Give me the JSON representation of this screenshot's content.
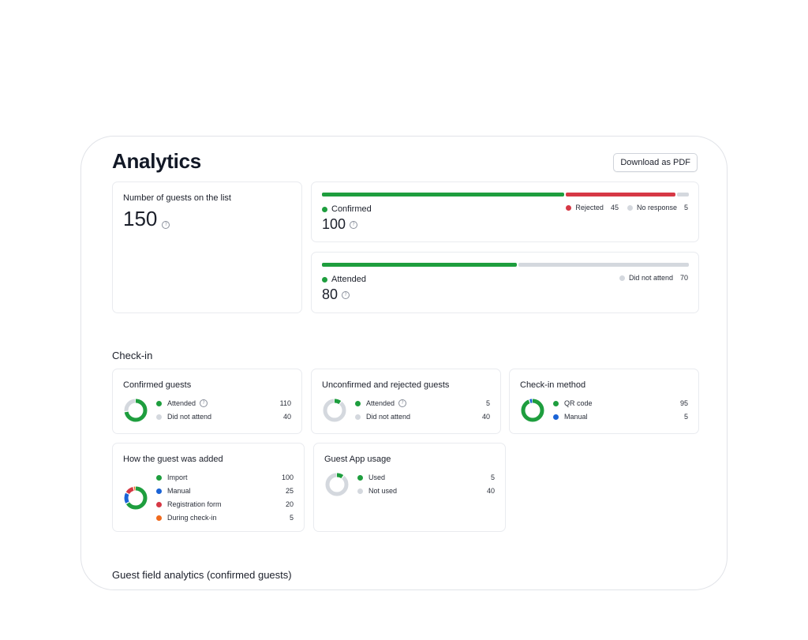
{
  "page": {
    "title": "Analytics",
    "download_label": "Download as PDF"
  },
  "colors": {
    "green": "#1e9e3e",
    "red": "#d63845",
    "gray": "#d4d8de",
    "blue": "#1a63d6",
    "orange": "#f06a1d"
  },
  "guests": {
    "label": "Number of guests on the list",
    "value": "150"
  },
  "confirmed": {
    "label": "Confirmed",
    "value": "100",
    "rejected_label": "Rejected",
    "rejected_value": "45",
    "noresponse_label": "No response",
    "noresponse_value": "5",
    "bar": [
      100,
      45,
      5
    ]
  },
  "attended": {
    "label": "Attended",
    "value": "80",
    "notattend_label": "Did not attend",
    "notattend_value": "70",
    "bar": [
      80,
      70
    ]
  },
  "checkin": {
    "heading": "Check-in",
    "confirmed_guests": {
      "title": "Confirmed guests",
      "items": [
        {
          "label": "Attended",
          "value": "110",
          "color": "#1e9e3e",
          "n": 110,
          "help": true
        },
        {
          "label": "Did not attend",
          "value": "40",
          "color": "#d4d8de",
          "n": 40
        }
      ]
    },
    "unconfirmed": {
      "title": "Unconfirmed and rejected guests",
      "items": [
        {
          "label": "Attended",
          "value": "5",
          "color": "#1e9e3e",
          "n": 5,
          "help": true
        },
        {
          "label": "Did not attend",
          "value": "40",
          "color": "#d4d8de",
          "n": 40
        }
      ]
    },
    "method": {
      "title": "Check-in method",
      "items": [
        {
          "label": "QR code",
          "value": "95",
          "color": "#1e9e3e",
          "n": 95
        },
        {
          "label": "Manual",
          "value": "5",
          "color": "#1a63d6",
          "n": 5
        }
      ]
    },
    "how_added": {
      "title": "How the guest was added",
      "items": [
        {
          "label": "Import",
          "value": "100",
          "color": "#1e9e3e",
          "n": 100
        },
        {
          "label": "Manual",
          "value": "25",
          "color": "#1a63d6",
          "n": 25
        },
        {
          "label": "Registration form",
          "value": "20",
          "color": "#d63845",
          "n": 20
        },
        {
          "label": "During check-in",
          "value": "5",
          "color": "#f06a1d",
          "n": 5
        }
      ]
    },
    "app_usage": {
      "title": "Guest App usage",
      "items": [
        {
          "label": "Used",
          "value": "5",
          "color": "#1e9e3e",
          "n": 5
        },
        {
          "label": "Not used",
          "value": "40",
          "color": "#d4d8de",
          "n": 40
        }
      ]
    }
  },
  "guest_field": {
    "heading": "Guest field analytics (confirmed guests)"
  },
  "help_glyph": "?"
}
